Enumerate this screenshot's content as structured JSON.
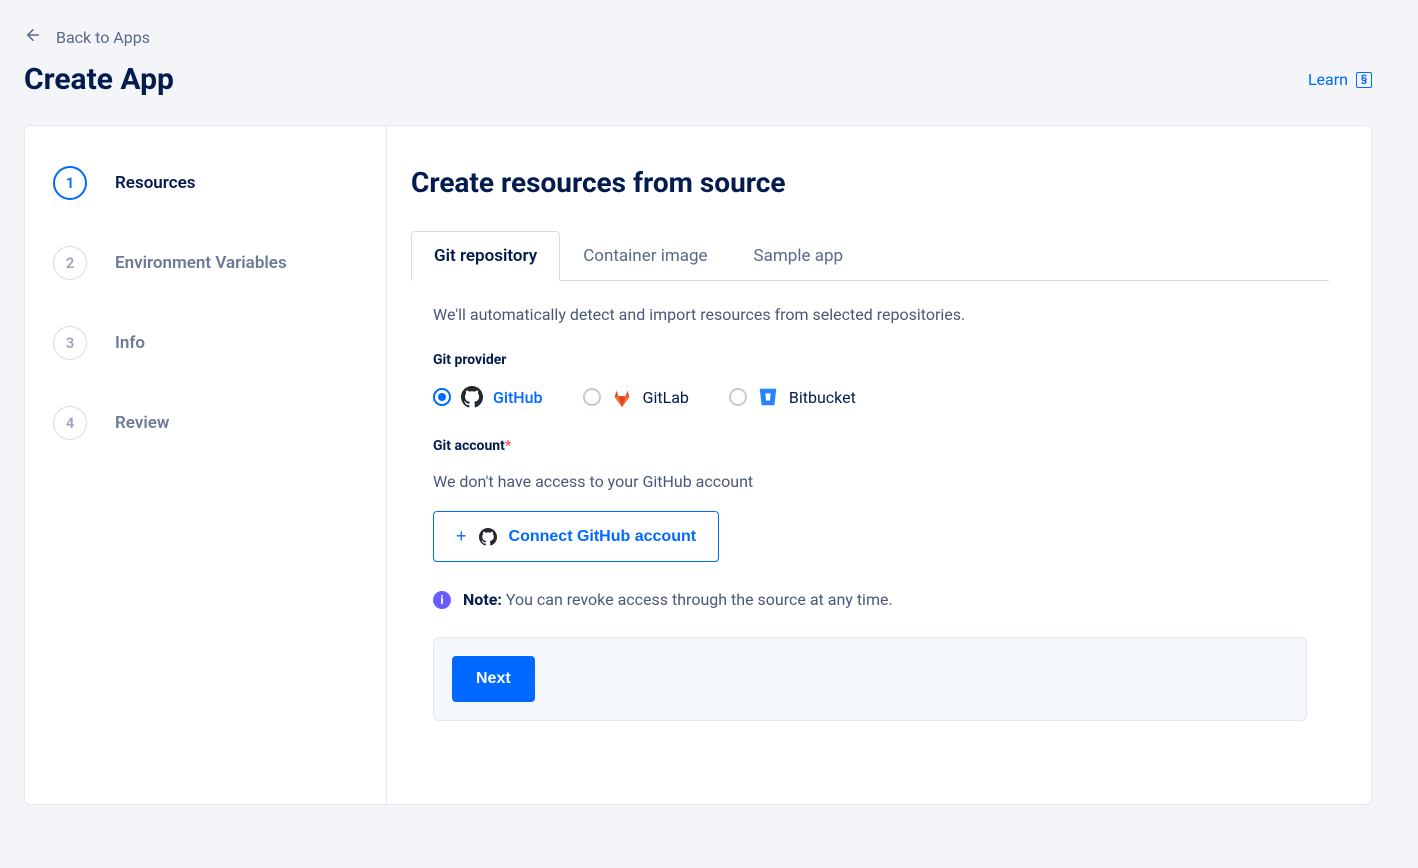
{
  "nav": {
    "back_label": "Back to Apps"
  },
  "header": {
    "title": "Create App",
    "learn_label": "Learn"
  },
  "stepper": {
    "steps": [
      {
        "num": "1",
        "label": "Resources",
        "active": true
      },
      {
        "num": "2",
        "label": "Environment Variables",
        "active": false
      },
      {
        "num": "3",
        "label": "Info",
        "active": false
      },
      {
        "num": "4",
        "label": "Review",
        "active": false
      }
    ]
  },
  "main": {
    "title": "Create resources from source",
    "tabs": [
      {
        "label": "Git repository",
        "active": true
      },
      {
        "label": "Container image",
        "active": false
      },
      {
        "label": "Sample app",
        "active": false
      }
    ],
    "description": "We'll automatically detect and import resources from selected repositories.",
    "provider_section": {
      "label": "Git provider",
      "options": [
        {
          "id": "github",
          "label": "GitHub",
          "selected": true
        },
        {
          "id": "gitlab",
          "label": "GitLab",
          "selected": false
        },
        {
          "id": "bitbucket",
          "label": "Bitbucket",
          "selected": false
        }
      ]
    },
    "account_section": {
      "label": "Git account",
      "required_mark": "*",
      "no_access_text": "We don't have access to your GitHub account",
      "connect_button": "Connect GitHub account"
    },
    "note": {
      "prefix": "Note:",
      "text": " You can revoke access through the source at any time."
    },
    "footer": {
      "next_label": "Next"
    }
  }
}
